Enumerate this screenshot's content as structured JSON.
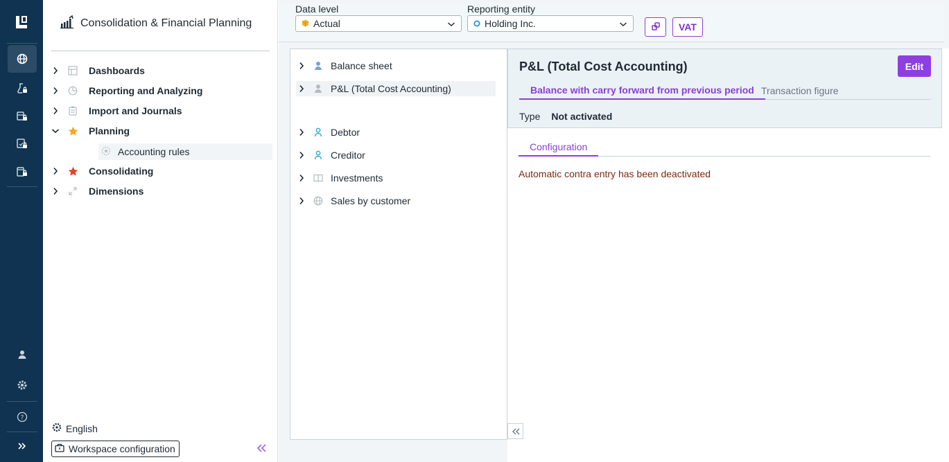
{
  "app": {
    "title": "Consolidation & Financial Planning"
  },
  "rail": {
    "icons": [
      "logo-icon",
      "globe-icon",
      "lab-flask-lock-icon",
      "data-lock-icon",
      "report-lock-icon",
      "cylinder-lock-icon",
      "user-icon",
      "settings-gear-icon",
      "help-icon",
      "expand-chevrons-icon"
    ]
  },
  "nav": {
    "items": [
      {
        "label": "Dashboards",
        "icon": "dashboard-icon"
      },
      {
        "label": "Reporting and Analyzing",
        "icon": "pie-chart-icon"
      },
      {
        "label": "Import and Journals",
        "icon": "clipboard-icon"
      },
      {
        "label": "Planning",
        "icon": "star-icon"
      },
      {
        "label": "Consolidating",
        "icon": "star-icon"
      },
      {
        "label": "Dimensions",
        "icon": "expand-arrows-icon"
      }
    ],
    "subitem": {
      "label": "Accounting rules",
      "icon": "gear-star-icon"
    },
    "language": "English",
    "workspace_config": "Workspace configuration"
  },
  "topbar": {
    "data_level_label": "Data level",
    "data_level_value": "Actual",
    "reporting_entity_label": "Reporting entity",
    "reporting_entity_value": "Holding Inc.",
    "vat_label": "VAT"
  },
  "tree": {
    "items": [
      {
        "label": "Balance sheet"
      },
      {
        "label": "P&L (Total Cost Accounting)"
      },
      {
        "label": "Debtor"
      },
      {
        "label": "Creditor"
      },
      {
        "label": "Investments"
      },
      {
        "label": "Sales by customer"
      }
    ]
  },
  "detail": {
    "title": "P&L (Total Cost Accounting)",
    "edit_label": "Edit",
    "tabs": [
      "Balance with carry forward from previous period",
      "Transaction figure"
    ],
    "type_key": "Type",
    "type_value": "Not activated",
    "subtab": "Configuration",
    "message": "Automatic contra entry has been deactivated"
  },
  "colors": {
    "rail_bg": "#0f3350",
    "accent": "#8e3fe0",
    "message_text": "#7a2a16"
  }
}
